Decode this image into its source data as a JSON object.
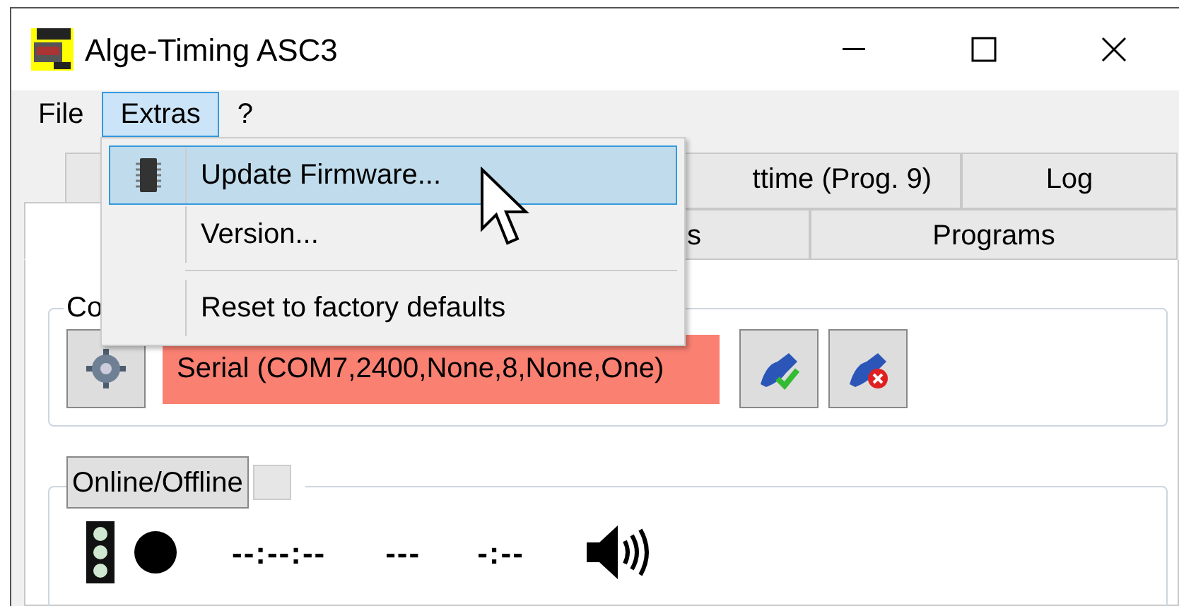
{
  "window": {
    "title": "Alge-Timing ASC3"
  },
  "menu_bar": [
    {
      "label": "File",
      "selected": false
    },
    {
      "label": "Extras",
      "selected": true
    },
    {
      "label": "?",
      "selected": false
    }
  ],
  "open_menu": [
    {
      "kind": "item",
      "label": "Update Firmware...",
      "selected": true
    },
    {
      "kind": "item",
      "label": "Version...",
      "selected": false
    },
    {
      "kind": "separator"
    },
    {
      "kind": "item",
      "label": "Reset to factory defaults",
      "selected": false
    }
  ],
  "tabs_row_1": [
    {
      "selected": false
    },
    {
      "label": "ttime (Prog. 9)",
      "selected": false
    },
    {
      "label": "Log",
      "selected": false
    }
  ],
  "tabs_row_2": [
    {
      "selected": true
    },
    {
      "label": "s",
      "selected": false
    },
    {
      "label": "Programs",
      "selected": false
    }
  ],
  "connection": {
    "legend": "Co",
    "value": "Serial (COM7,2400,None,8,None,One)"
  },
  "online": {
    "button": "Online/Offline",
    "checked": false,
    "time": "--:--:--",
    "field_2": "---",
    "field_3": "-:--"
  }
}
